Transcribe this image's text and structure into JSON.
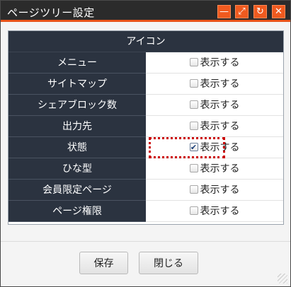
{
  "window": {
    "title": "ページツリー設定",
    "buttons": {
      "minimize_icon": "—",
      "maximize_icon": "⤢",
      "refresh_icon": "↻",
      "close_icon": "✕"
    },
    "accent_color": "#e8531a",
    "title_bg": "#2b2b2b"
  },
  "table": {
    "header": "アイコン",
    "rows": [
      {
        "label": "メニュー",
        "option": "表示する",
        "checked": false
      },
      {
        "label": "サイトマップ",
        "option": "表示する",
        "checked": false
      },
      {
        "label": "シェアブロック数",
        "option": "表示する",
        "checked": false
      },
      {
        "label": "出力先",
        "option": "表示する",
        "checked": false
      },
      {
        "label": "状態",
        "option": "表示する",
        "checked": true
      },
      {
        "label": "ひな型",
        "option": "表示する",
        "checked": false
      },
      {
        "label": "会員限定ページ",
        "option": "表示する",
        "checked": false
      },
      {
        "label": "ページ権限",
        "option": "表示する",
        "checked": false
      }
    ]
  },
  "footer": {
    "save_label": "保存",
    "close_label": "閉じる"
  }
}
